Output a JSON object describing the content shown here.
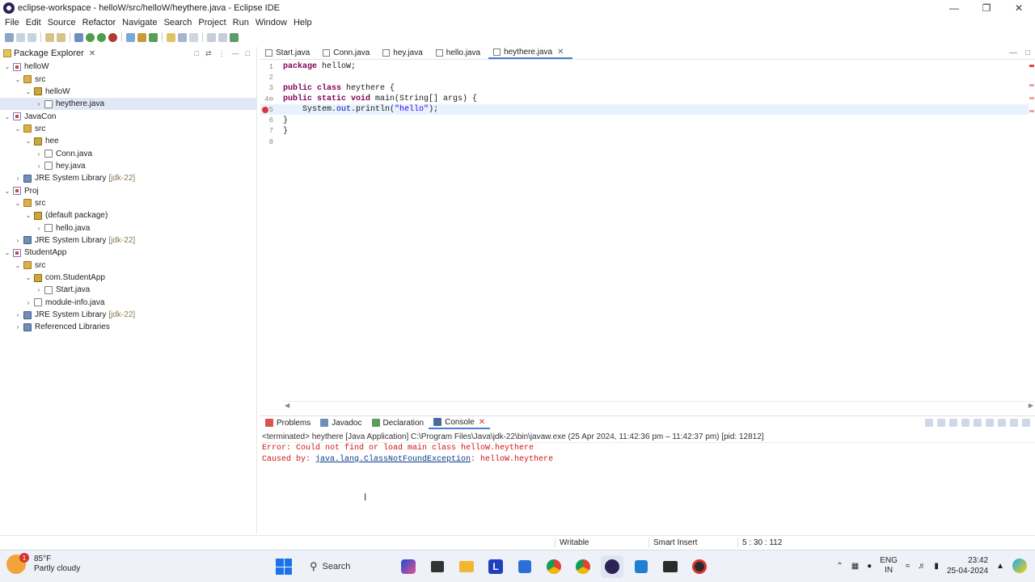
{
  "window": {
    "title": "eclipse-workspace - helloW/src/helloW/heythere.java - Eclipse IDE"
  },
  "menu": [
    "File",
    "Edit",
    "Source",
    "Refactor",
    "Navigate",
    "Search",
    "Project",
    "Run",
    "Window",
    "Help"
  ],
  "package_explorer": {
    "title": "Package Explorer",
    "tree": [
      {
        "label": "helloW",
        "type": "project",
        "depth": 0,
        "expanded": true
      },
      {
        "label": "src",
        "type": "src",
        "depth": 1,
        "expanded": true
      },
      {
        "label": "helloW",
        "type": "package",
        "depth": 2,
        "expanded": true
      },
      {
        "label": "heythere.java",
        "type": "java",
        "depth": 3,
        "expanded": false,
        "selected": true
      },
      {
        "label": "JavaCon",
        "type": "project",
        "depth": 0,
        "expanded": true
      },
      {
        "label": "src",
        "type": "src",
        "depth": 1,
        "expanded": true
      },
      {
        "label": "hee",
        "type": "package",
        "depth": 2,
        "expanded": true
      },
      {
        "label": "Conn.java",
        "type": "java",
        "depth": 3,
        "expanded": false
      },
      {
        "label": "hey.java",
        "type": "java",
        "depth": 3,
        "expanded": false
      },
      {
        "label": "JRE System Library",
        "suffix": "[jdk-22]",
        "type": "lib",
        "depth": 1,
        "expanded": false
      },
      {
        "label": "Proj",
        "type": "project",
        "depth": 0,
        "expanded": true
      },
      {
        "label": "src",
        "type": "src",
        "depth": 1,
        "expanded": true
      },
      {
        "label": "(default package)",
        "type": "package",
        "depth": 2,
        "expanded": true
      },
      {
        "label": "hello.java",
        "type": "java",
        "depth": 3,
        "expanded": false
      },
      {
        "label": "JRE System Library",
        "suffix": "[jdk-22]",
        "type": "lib",
        "depth": 1,
        "expanded": false
      },
      {
        "label": "StudentApp",
        "type": "project",
        "depth": 0,
        "expanded": true
      },
      {
        "label": "src",
        "type": "src",
        "depth": 1,
        "expanded": true
      },
      {
        "label": "com.StudentApp",
        "type": "package",
        "depth": 2,
        "expanded": true
      },
      {
        "label": "Start.java",
        "type": "java",
        "depth": 3,
        "expanded": false
      },
      {
        "label": "module-info.java",
        "type": "java",
        "depth": 2,
        "expanded": false
      },
      {
        "label": "JRE System Library",
        "suffix": "[jdk-22]",
        "type": "lib",
        "depth": 1,
        "expanded": false
      },
      {
        "label": "Referenced Libraries",
        "type": "lib",
        "depth": 1,
        "expanded": false
      }
    ]
  },
  "editor": {
    "tabs": [
      {
        "label": "Start.java",
        "active": false
      },
      {
        "label": "Conn.java",
        "active": false
      },
      {
        "label": "hey.java",
        "active": false
      },
      {
        "label": "hello.java",
        "active": false
      },
      {
        "label": "heythere.java",
        "active": true
      }
    ],
    "lines": [
      {
        "n": "1",
        "html": "<span class='kw'>package</span> helloW;"
      },
      {
        "n": "2",
        "html": ""
      },
      {
        "n": "3",
        "html": "<span class='kw'>public class</span> heythere {"
      },
      {
        "n": "4⊖",
        "html": "<span class='kw'>public static void</span> main(String[] args) {"
      },
      {
        "n": "5",
        "html": "    System.<span class='fld'>out</span>.println(<span class='str'>\"hello\"</span>);",
        "highlight": true,
        "error": true
      },
      {
        "n": "6",
        "html": "}"
      },
      {
        "n": "7",
        "html": "}"
      },
      {
        "n": "8",
        "html": ""
      }
    ]
  },
  "bottom": {
    "tabs": [
      {
        "label": "Problems",
        "active": false
      },
      {
        "label": "Javadoc",
        "active": false
      },
      {
        "label": "Declaration",
        "active": false
      },
      {
        "label": "Console",
        "active": true
      }
    ],
    "terminated": "<terminated> heythere [Java Application] C:\\Program Files\\Java\\jdk-22\\bin\\javaw.exe  (25 Apr 2024, 11:42:36 pm – 11:42:37 pm) [pid: 12812]",
    "error_line": "Error: Could not find or load main class helloW.heythere",
    "caused_prefix": "Caused by: ",
    "caused_link": "java.lang.ClassNotFoundException",
    "caused_suffix": ": helloW.heythere"
  },
  "status": {
    "writable": "Writable",
    "insert_mode": "Smart Insert",
    "position": "5 : 30 : 112"
  },
  "taskbar": {
    "weather_temp": "85°F",
    "weather_desc": "Partly cloudy",
    "weather_badge": "1",
    "search_label": "Search",
    "lang1": "ENG",
    "lang2": "IN",
    "time": "23:42",
    "date": "25-04-2024"
  }
}
